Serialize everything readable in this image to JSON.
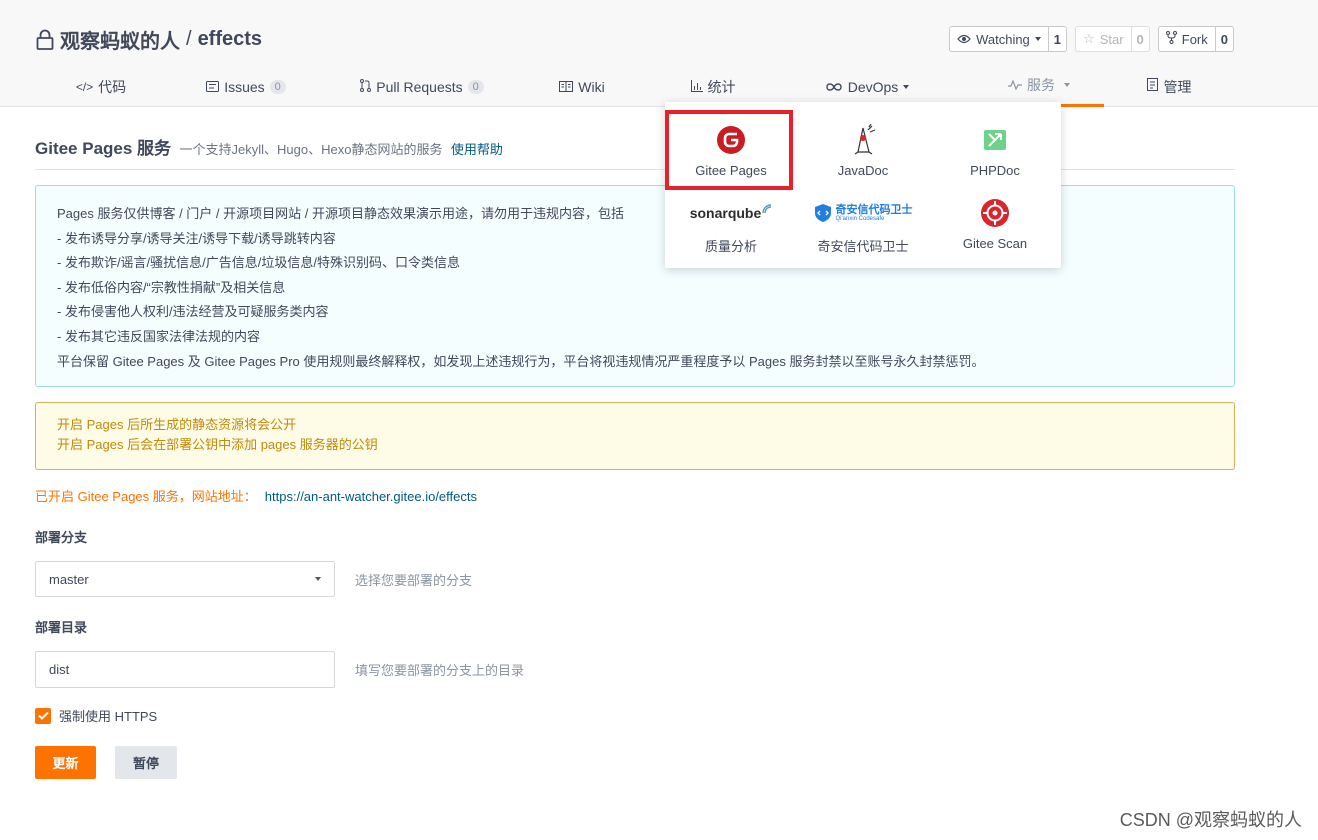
{
  "repo": {
    "owner": "观察蚂蚁的人",
    "separator": "/",
    "name": "effects"
  },
  "actions": {
    "watch": {
      "label": "Watching",
      "count": "1"
    },
    "star": {
      "label": "Star",
      "count": "0"
    },
    "fork": {
      "label": "Fork",
      "count": "0"
    }
  },
  "tabs": [
    {
      "label": "代码"
    },
    {
      "label": "Issues",
      "count": "0"
    },
    {
      "label": "Pull Requests",
      "count": "0"
    },
    {
      "label": "Wiki"
    },
    {
      "label": "统计"
    },
    {
      "label": "DevOps"
    },
    {
      "label": "服务"
    },
    {
      "label": "管理"
    }
  ],
  "services_menu": {
    "items": [
      {
        "label": "Gitee Pages",
        "icon": "gitee-pages-icon"
      },
      {
        "label": "JavaDoc",
        "icon": "javadoc-duke-icon"
      },
      {
        "label": "PHPDoc",
        "icon": "phpdoc-icon"
      },
      {
        "label": "质量分析",
        "icon": "sonarqube-logo",
        "logo_text": "sonarqube"
      },
      {
        "label": "奇安信代码卫士",
        "icon": "qianxin-codesafe-logo",
        "logo_text": "奇安信代码卫士",
        "logo_sub": "Qi'anxin Codesafe"
      },
      {
        "label": "Gitee Scan",
        "icon": "gitee-scan-icon"
      }
    ]
  },
  "page": {
    "title": "Gitee Pages 服务",
    "subtitle": "一个支持Jekyll、Hugo、Hexo静态网站的服务",
    "help_link": "使用帮助"
  },
  "notice": {
    "lines": [
      "Pages 服务仅供博客 / 门户 / 开源项目网站 / 开源项目静态效果演示用途，请勿用于违规内容，包括",
      "- 发布诱导分享/诱导关注/诱导下载/诱导跳转内容",
      "- 发布欺诈/谣言/骚扰信息/广告信息/垃圾信息/特殊识别码、口令类信息",
      "- 发布低俗内容/“宗教性捐献”及相关信息",
      "- 发布侵害他人权利/违法经营及可疑服务类内容",
      "- 发布其它违反国家法律法规的内容",
      "平台保留 Gitee Pages 及 Gitee Pages Pro 使用规则最终解释权，如发现上述违规行为，平台将视违规情况严重程度予以 Pages 服务封禁以至账号永久封禁惩罚。"
    ]
  },
  "warning": {
    "lines": [
      "开启 Pages 后所生成的静态资源将会公开",
      "开启 Pages 后会在部署公钥中添加 pages 服务器的公钥"
    ]
  },
  "status": {
    "text": "已开启 Gitee Pages 服务，网站地址：",
    "url": "https://an-ant-watcher.gitee.io/effects"
  },
  "form": {
    "branch_label": "部署分支",
    "branch_value": "master",
    "branch_hint": "选择您要部署的分支",
    "dir_label": "部署目录",
    "dir_value": "dist",
    "dir_hint": "填写您要部署的分支上的目录",
    "https_label": "强制使用 HTTPS",
    "https_checked": true,
    "update_button": "更新",
    "pause_button": "暂停"
  },
  "watermark": "CSDN @观察蚂蚁的人",
  "colors": {
    "accent": "#fe7300",
    "link": "#005980",
    "highlight_box": "#e8202a",
    "info_bg": "#f4feff",
    "warn_bg": "#fefbe6",
    "warn_text": "#c08a0b"
  }
}
